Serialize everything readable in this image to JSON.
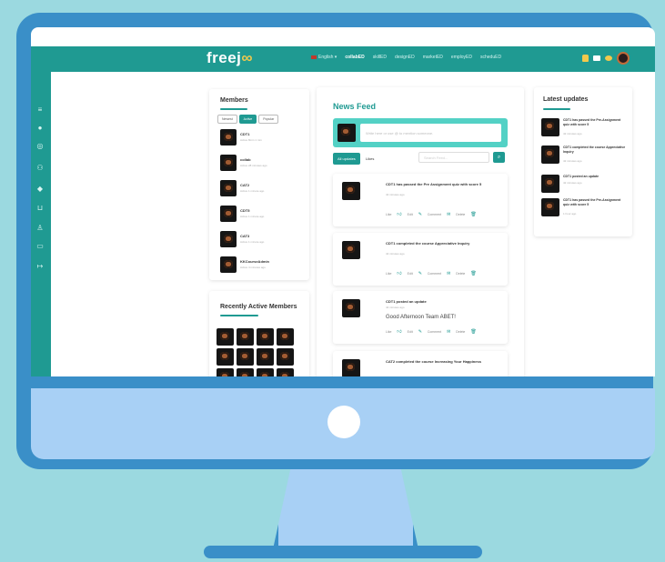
{
  "topbar": {
    "logo_text": "freej",
    "language": "English",
    "nav": [
      "collabED",
      "skillED",
      "designED",
      "marketED",
      "employED",
      "scheduED"
    ],
    "active_nav": "collabED"
  },
  "sidebar": {
    "icons": [
      "menu-icon",
      "avatar",
      "user-circle-icon",
      "users-icon",
      "tag-icon",
      "cart-icon",
      "person-icon",
      "id-card-icon",
      "logout-icon"
    ]
  },
  "members": {
    "title": "Members",
    "tabs": [
      "Newest",
      "Active",
      "Popular"
    ],
    "active_tab": "Active",
    "items": [
      {
        "name": "CDT1",
        "sub": "Active 8min 1 min"
      },
      {
        "name": "collab",
        "sub": "Active 28 minutes ago"
      },
      {
        "name": "CAT2",
        "sub": "Active 1 minute ago"
      },
      {
        "name": "CDT5",
        "sub": "Active 1 minute ago"
      },
      {
        "name": "CAT3",
        "sub": "Active 1 minute ago"
      },
      {
        "name": "KKCourseAdmin",
        "sub": "Active 4 minutes ago"
      }
    ]
  },
  "recent": {
    "title": "Recently Active Members",
    "count": 12
  },
  "feed": {
    "title": "News Feed",
    "composer_placeholder": "Write here or use @ to mention someone.",
    "filter_all": "All updates",
    "filter_likes": "Likes",
    "search_placeholder": "Search Feed...",
    "posts": [
      {
        "text": "CDT1 has passed the  Pre Assignment quiz with score 5",
        "time": "42 minutes ago",
        "message": ""
      },
      {
        "text": "CDT1 completed the course  Appreciative Inquiry",
        "time": "42 minutes ago",
        "message": ""
      },
      {
        "text": "CDT1 posted an update",
        "time": "42 minutes ago",
        "message": "Good Afternoon Team ABET!"
      },
      {
        "text": "CAT2 completed the course  Increasing Your Happiness",
        "time": "",
        "message": ""
      }
    ],
    "actions": [
      "Like",
      "Edit",
      "Comment",
      "Delete"
    ]
  },
  "latest": {
    "title": "Latest updates",
    "items": [
      {
        "text": "CDT1 has passed the Pre-Assignment quiz with score 5",
        "time": "42 minutes ago"
      },
      {
        "text": "CDT1 completed the course Appreciative Inquiry",
        "time": "42 minutes ago"
      },
      {
        "text": "CDT1 posted an update",
        "time": "42 minutes ago"
      },
      {
        "text": "CDT1 has passed the Pre-Assignment quiz with score 5",
        "time": "1 hour ago"
      }
    ]
  },
  "colors": {
    "brand_teal": "#1f9a92",
    "monitor_blue": "#3a8fc8",
    "chin_blue": "#a8d0f5",
    "background": "#9bd9e0"
  }
}
